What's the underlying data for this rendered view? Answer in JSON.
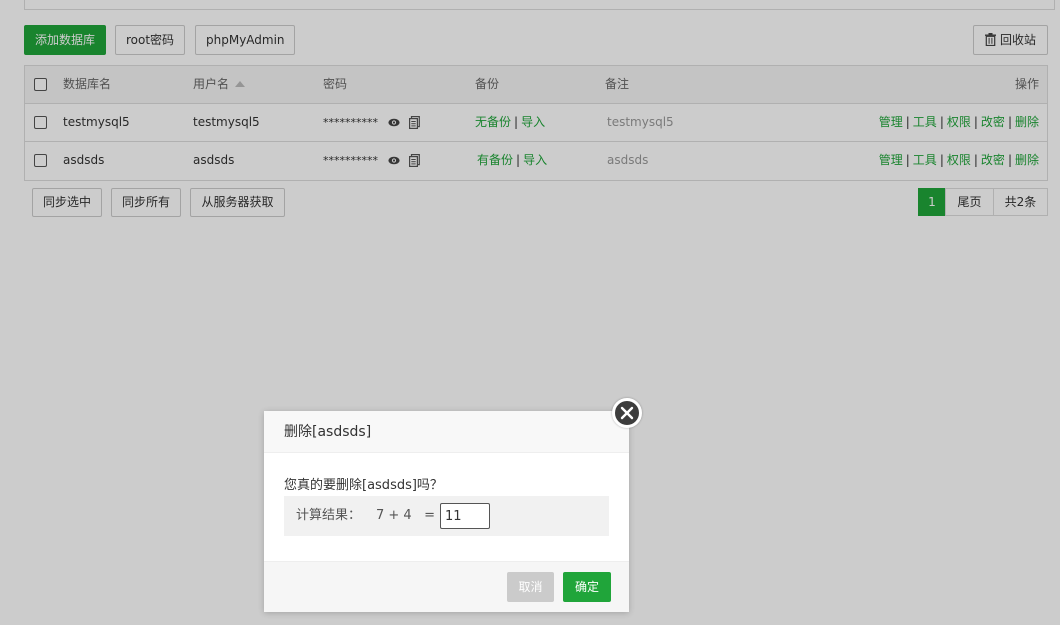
{
  "toolbar": {
    "add_db": "添加数据库",
    "root_pwd": "root密码",
    "phpmyadmin": "phpMyAdmin",
    "recycle": "回收站"
  },
  "table": {
    "headers": {
      "name": "数据库名",
      "user": "用户名",
      "password": "密码",
      "backup": "备份",
      "note": "备注",
      "ops": "操作"
    },
    "rows": [
      {
        "name": "testmysql5",
        "user": "testmysql5",
        "password": "**********",
        "backup": "无备份",
        "import": "导入",
        "note": "testmysql5"
      },
      {
        "name": "asdsds",
        "user": "asdsds",
        "password": "**********",
        "backup": "有备份",
        "import": "导入",
        "note": "asdsds"
      }
    ],
    "ops": {
      "manage": "管理",
      "tools": "工具",
      "perm": "权限",
      "chpwd": "改密",
      "delete": "删除",
      "sep": "|"
    }
  },
  "footer": {
    "sync_selected": "同步选中",
    "sync_all": "同步所有",
    "fetch_server": "从服务器获取",
    "page_current": "1",
    "page_last": "尾页",
    "total": "共2条"
  },
  "dialog": {
    "title": "删除[asdsds]",
    "message": "您真的要删除[asdsds]吗？",
    "calc_label": "计算结果：",
    "calc_expr": "7 + 4   =",
    "calc_value": "11",
    "cancel": "取消",
    "confirm": "确定"
  },
  "colors": {
    "accent": "#20a53a",
    "overlay": "rgba(0,0,0,0.2)"
  }
}
